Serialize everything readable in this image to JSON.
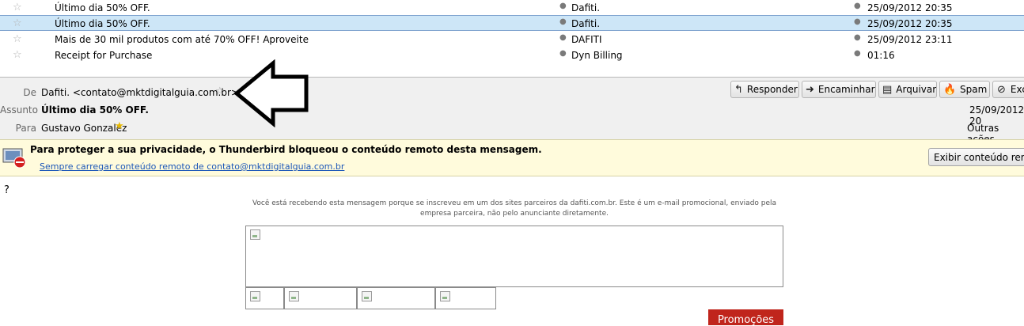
{
  "message_list": [
    {
      "subject": "Último dia 50% OFF.",
      "sender": "Dafiti.",
      "date": "25/09/2012 20:35",
      "selected": false
    },
    {
      "subject": "Último dia 50% OFF.",
      "sender": "Dafiti.",
      "date": "25/09/2012 20:35",
      "selected": true
    },
    {
      "subject": "Mais de 30 mil produtos com até 70% OFF! Aproveite",
      "sender": "DAFITI",
      "date": "25/09/2012 23:11",
      "selected": false
    },
    {
      "subject": "Receipt for Purchase",
      "sender": "Dyn Billing",
      "date": "01:16",
      "selected": false
    }
  ],
  "header": {
    "from_label": "De",
    "from_value": "Dafiti. <contato@mktdigitalguia.com.br>",
    "subject_label": "Assunto",
    "subject_value": "Último dia 50% OFF.",
    "to_label": "Para",
    "to_value": "Gustavo Gonzalez",
    "date": "25/09/2012 20",
    "other_actions": "Outras ações",
    "buttons": {
      "reply": "Responder",
      "forward": "Encaminhar",
      "archive": "Arquivar",
      "spam": "Spam",
      "delete": "Exc"
    }
  },
  "remote_notice": {
    "text": "Para proteger a sua privacidade, o Thunderbird bloqueou o conteúdo remoto desta mensagem.",
    "link": "Sempre carregar conteúdo remoto de contato@mktdigitalguia.com.br",
    "button": "Exibir conteúdo remoto"
  },
  "body": {
    "question_mark": "?",
    "disclaimer_line1": "Você está recebendo esta mensagem porque se inscreveu em um dos sites parceiros da dafiti.com.br. Este é um e-mail promocional, enviado pela",
    "disclaimer_line2": "empresa parceira, não pelo anunciante diretamente.",
    "promo_button": "Promoções"
  },
  "colors": {
    "selected_row": "#cde6f7",
    "notice_bg": "#fffbdc",
    "promo": "#c0251c",
    "link": "#1b56b8"
  },
  "icons": [
    "star-icon",
    "reply-icon",
    "forward-icon",
    "archive-icon",
    "spam-icon",
    "delete-icon",
    "blocked-image-icon",
    "arrow-annotation-icon",
    "broken-image-icon"
  ]
}
